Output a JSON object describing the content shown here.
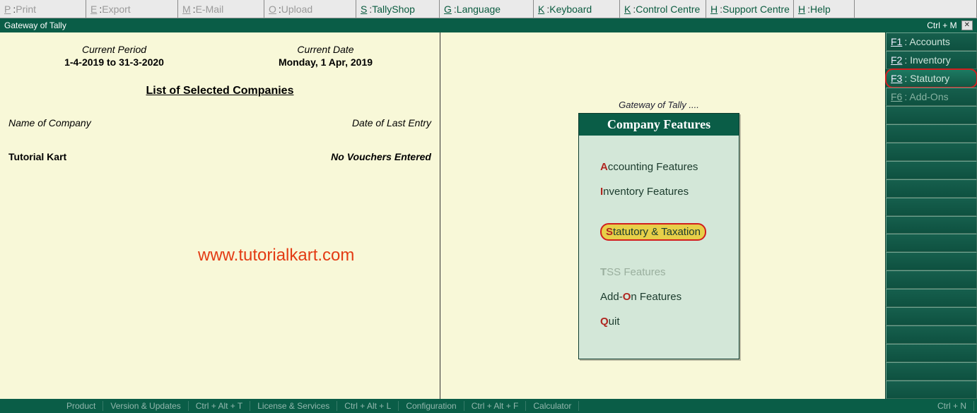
{
  "toolbar": [
    {
      "hotkey": "P",
      "label": "Print",
      "enabled": false
    },
    {
      "hotkey": "E",
      "label": "Export",
      "enabled": false
    },
    {
      "hotkey": "M",
      "label": "E-Mail",
      "enabled": false
    },
    {
      "hotkey": "O",
      "label": "Upload",
      "enabled": false
    },
    {
      "hotkey": "S",
      "label": "TallyShop",
      "enabled": true
    },
    {
      "hotkey": "G",
      "label": "Language",
      "enabled": true
    },
    {
      "hotkey": "K",
      "label": "Keyboard",
      "enabled": true
    },
    {
      "hotkey": "K",
      "label": "Control Centre",
      "enabled": true
    },
    {
      "hotkey": "H",
      "label": "Support Centre",
      "enabled": true
    },
    {
      "hotkey": "H",
      "label": "Help",
      "enabled": true
    }
  ],
  "header": {
    "breadcrumb": "Gateway of Tally",
    "shortcut": "Ctrl + M"
  },
  "period": {
    "period_label": "Current Period",
    "period_value": "1-4-2019 to 31-3-2020",
    "date_label": "Current Date",
    "date_value": "Monday, 1 Apr, 2019"
  },
  "companies": {
    "list_title": "List of Selected Companies",
    "name_header": "Name of Company",
    "entry_header": "Date of Last Entry",
    "rows": [
      {
        "name": "Tutorial Kart",
        "last_entry": "No Vouchers Entered"
      }
    ]
  },
  "watermark": "www.tutorialkart.com",
  "gateway": {
    "caption": "Gateway of Tally ....",
    "title": "Company Features",
    "items": [
      {
        "hotkey": "A",
        "label": "ccounting Features",
        "enabled": true,
        "selected": false
      },
      {
        "hotkey": "I",
        "label": "nventory Features",
        "enabled": true,
        "selected": false
      },
      {
        "hotkey": "S",
        "label": "tatutory & Taxation",
        "enabled": true,
        "selected": true
      },
      {
        "hotkey": "T",
        "label": "SS Features",
        "enabled": false,
        "selected": false
      },
      {
        "hotkey": "O",
        "label": "Add-",
        "tail": "n Features",
        "enabled": true,
        "selected": false,
        "prefix": true
      },
      {
        "hotkey": "Q",
        "label": "uit",
        "enabled": true,
        "selected": false
      }
    ]
  },
  "fkeys": [
    {
      "key": "F1",
      "label": "Accounts",
      "state": "normal"
    },
    {
      "key": "F2",
      "label": "Inventory",
      "state": "normal"
    },
    {
      "key": "F3",
      "label": "Statutory",
      "state": "highlighted"
    },
    {
      "key": "F6",
      "label": "Add-Ons",
      "state": "dimmed"
    }
  ],
  "footer": {
    "cells": [
      "Product",
      "Version & Updates",
      "Ctrl + Alt + T",
      "License & Services",
      "Ctrl + Alt + L",
      "Configuration",
      "Ctrl + Alt + F",
      "Calculator",
      "Ctrl + N"
    ]
  }
}
